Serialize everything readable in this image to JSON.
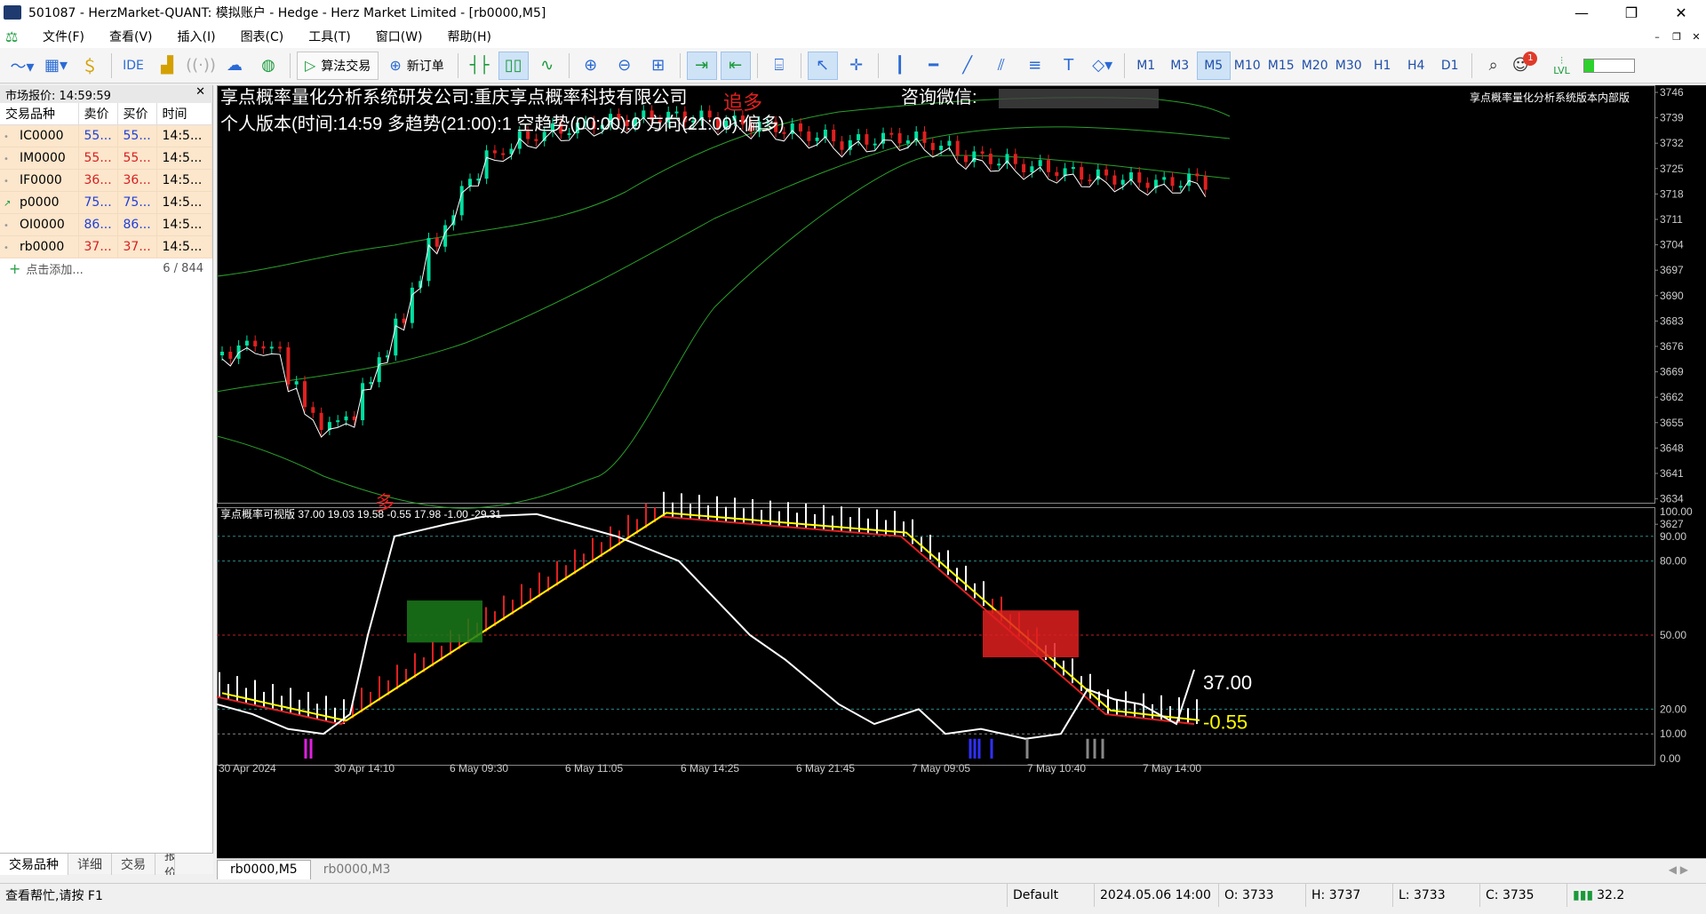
{
  "window": {
    "title": "501087 - HerzMarket-QUANT: 模拟账户 - Hedge - Herz Market Limited - [rb0000,M5]"
  },
  "menu": [
    "文件(F)",
    "查看(V)",
    "插入(I)",
    "图表(C)",
    "工具(T)",
    "窗口(W)",
    "帮助(H)"
  ],
  "toolbar": {
    "ide": "IDE",
    "algo_trading": "算法交易",
    "new_order": "新订单",
    "timeframes": [
      "M1",
      "M3",
      "M5",
      "M10",
      "M15",
      "M20",
      "M30",
      "H1",
      "H4",
      "D1"
    ],
    "active_timeframe": "M5",
    "notify_count": "1",
    "lvl": "LVL",
    "lvl_fraction": 0.18
  },
  "market_watch": {
    "header": "市场报价: 14:59:59",
    "columns": [
      "交易品种",
      "卖价",
      "买价",
      "时间"
    ],
    "rows": [
      {
        "symbol": "IC0000",
        "bid": "55...",
        "ask": "55...",
        "time": "14:5...",
        "color": "blue",
        "trend": "dot"
      },
      {
        "symbol": "IM0000",
        "bid": "55...",
        "ask": "55...",
        "time": "14:5...",
        "color": "red",
        "trend": "dot"
      },
      {
        "symbol": "IF0000",
        "bid": "36...",
        "ask": "36...",
        "time": "14:5...",
        "color": "red",
        "trend": "dot"
      },
      {
        "symbol": "p0000",
        "bid": "75...",
        "ask": "75...",
        "time": "14:5...",
        "color": "blue",
        "trend": "up"
      },
      {
        "symbol": "OI0000",
        "bid": "86...",
        "ask": "86...",
        "time": "14:5...",
        "color": "blue",
        "trend": "dot"
      },
      {
        "symbol": "rb0000",
        "bid": "37...",
        "ask": "37...",
        "time": "14:5...",
        "color": "red",
        "trend": "dot"
      }
    ],
    "add_label": "点击添加...",
    "count": "6 / 844",
    "tabs": [
      "交易品种",
      "详细",
      "交易",
      "报价"
    ]
  },
  "chart": {
    "header_line1": "享点概率量化分析系统研发公司:重庆享点概率科技有限公司",
    "header_consult": "咨询微信:",
    "header_line2": "个人版本(时间:14:59 多趋势(21:00):1 空趋势(00:00):0 方向(21:00):偏多)",
    "corner_label": "享点概率量化分析系统版本内部版",
    "signal_long": "多",
    "signal_short": "追多",
    "price_axis": [
      "3746",
      "3739",
      "3732",
      "3725",
      "3718",
      "3711",
      "3704",
      "3697",
      "3690",
      "3683",
      "3676",
      "3669",
      "3662",
      "3655",
      "3648",
      "3641",
      "3634",
      "3627"
    ],
    "indicator_label": "享点概率可视版 37.00 19.03 19.58 -0.55 17.98 -1.00 -29.31",
    "indicator_axis": [
      "100.00",
      "90.00",
      "80.00",
      "50.00",
      "20.00",
      "10.00",
      "0.00"
    ],
    "indicator_value1": "37.00",
    "indicator_value2": "-0.55",
    "time_axis": [
      "30 Apr 2024",
      "30 Apr 14:10",
      "6 May 09:30",
      "6 May 11:05",
      "6 May 14:25",
      "6 May 21:45",
      "7 May 09:05",
      "7 May 10:40",
      "7 May 14:00"
    ],
    "colors": {
      "bg": "#000000",
      "up": "#00e0a0",
      "down": "#e02020",
      "band": "#2aa02a",
      "yellow": "#ffff00"
    }
  },
  "chart_tabs": [
    "rb0000,M5",
    "rb0000,M3"
  ],
  "status": {
    "help": "查看帮忙,请按 F1",
    "profile": "Default",
    "datetime": "2024.05.06 14:00",
    "open": "O: 3733",
    "high": "H: 3737",
    "low": "L: 3733",
    "close": "C: 3735",
    "speed": "32.2"
  }
}
